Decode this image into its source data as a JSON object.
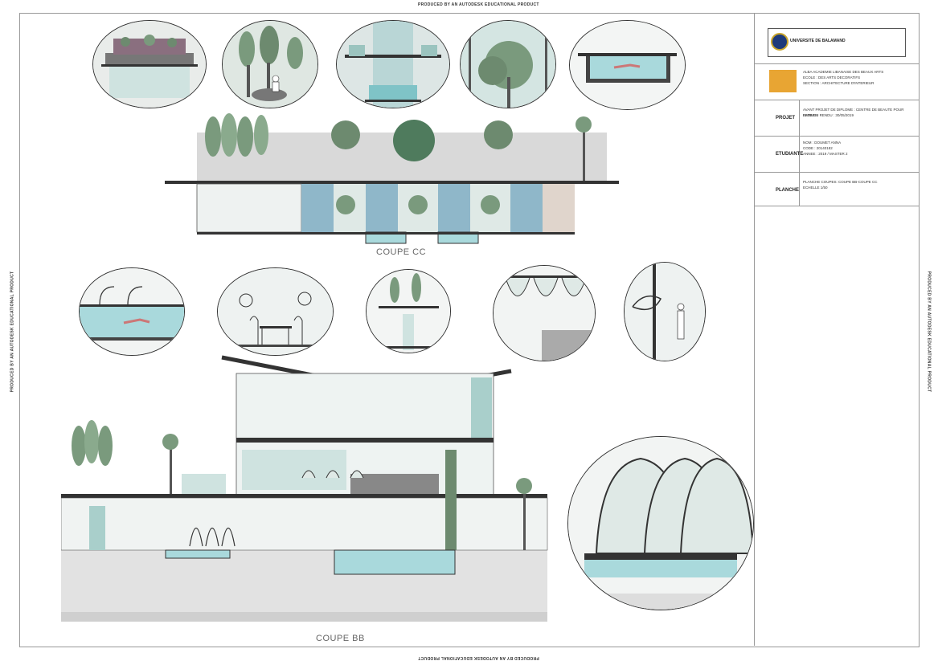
{
  "stamps": {
    "top": "PRODUCED BY AN AUTODESK EDUCATIONAL PRODUCT",
    "bottom": "PRODUCED BY AN AUTODESK EDUCATIONAL PRODUCT",
    "left": "PRODUCED BY AN AUTODESK EDUCATIONAL PRODUCT",
    "right": "PRODUCED BY AN AUTODESK EDUCATIONAL PRODUCT"
  },
  "captions": {
    "coupe_cc": "COUPE CC",
    "coupe_bb": "COUPE BB"
  },
  "title_block": {
    "university": "UNIVERSITE DE BALAMAND",
    "school": [
      "ALBA ACADEMIE LIBANAISE DES BEAUX ARTS",
      "ECOLE : DES ARTS DECORATIFS",
      "SECTION : ARCHITECTURE D'INTERIEUR"
    ],
    "projet_label": "PROJET",
    "projet_text": [
      "AVANT PROJET DE DIPLOME : CENTRE DE BEAUTE POUR FEMMES",
      "DATE DU RENDU : 30/05/2019"
    ],
    "etudiante_label": "ETUDIANTE",
    "etudiante_text": [
      "NOM : DOUMET ANNA",
      "CODE : 20140182",
      "ANNEE : 2019 / MASTER 2"
    ],
    "planche_label": "PLANCHE",
    "planche_text": [
      "PLANCHE COUPES: COUPE BB-COUPE CC",
      "ECHELLE 1/50"
    ]
  },
  "colors": {
    "glass": "#a9cfcb",
    "water": "#7fc3c7",
    "tree": "#7a9a7d",
    "wall": "#d8d8d8"
  }
}
